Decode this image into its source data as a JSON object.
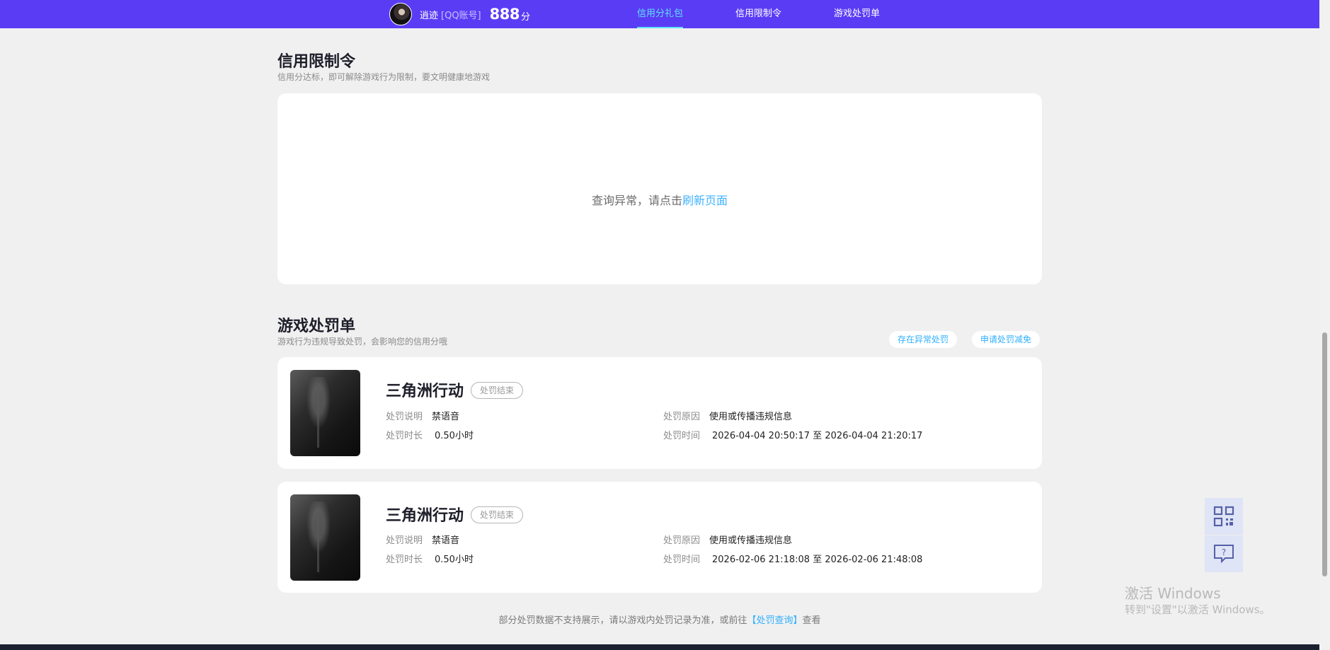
{
  "header": {
    "username": "逍迹",
    "account_type": "[QQ账号]",
    "score": "888",
    "score_unit": "分",
    "nav": [
      {
        "label": "信用分礼包",
        "active": true
      },
      {
        "label": "信用限制令",
        "active": false
      },
      {
        "label": "游戏处罚单",
        "active": false
      }
    ]
  },
  "restriction": {
    "title": "信用限制令",
    "subtitle": "信用分达标，即可解除游戏行为限制，要文明健康地游戏",
    "error_text": "查询异常，请点击",
    "error_link": "刷新页面"
  },
  "penalty": {
    "title": "游戏处罚单",
    "subtitle": "游戏行为违规导致处罚，会影响您的信用分哦",
    "btn_abnormal": "存在异常处罚",
    "btn_appeal": "申请处罚减免",
    "labels": {
      "desc": "处罚说明",
      "duration": "处罚时长",
      "reason": "处罚原因",
      "time": "处罚时间"
    },
    "items": [
      {
        "game": "三角洲行动",
        "status": "处罚结束",
        "desc": "禁语音",
        "duration": "0.50小时",
        "reason": "使用或传播违规信息",
        "time_start": "2026-04-04 20:50:17",
        "time_sep": "至",
        "time_end": "2026-04-04 21:20:17"
      },
      {
        "game": "三角洲行动",
        "status": "处罚结束",
        "desc": "禁语音",
        "duration": "0.50小时",
        "reason": "使用或传播违规信息",
        "time_start": "2026-02-06 21:18:08",
        "time_sep": "至",
        "time_end": "2026-02-06 21:48:08"
      }
    ],
    "footer_text": "部分处罚数据不支持展示，请以游戏内处罚记录为准，或前往",
    "footer_link": "【处罚查询】",
    "footer_suffix": "查看"
  },
  "watermark": {
    "line1": "激活 Windows",
    "line2": "转到\"设置\"以激活 Windows。"
  },
  "floating": {
    "qr_icon": "qrcode-icon",
    "feedback_icon": "help-chat-icon"
  }
}
